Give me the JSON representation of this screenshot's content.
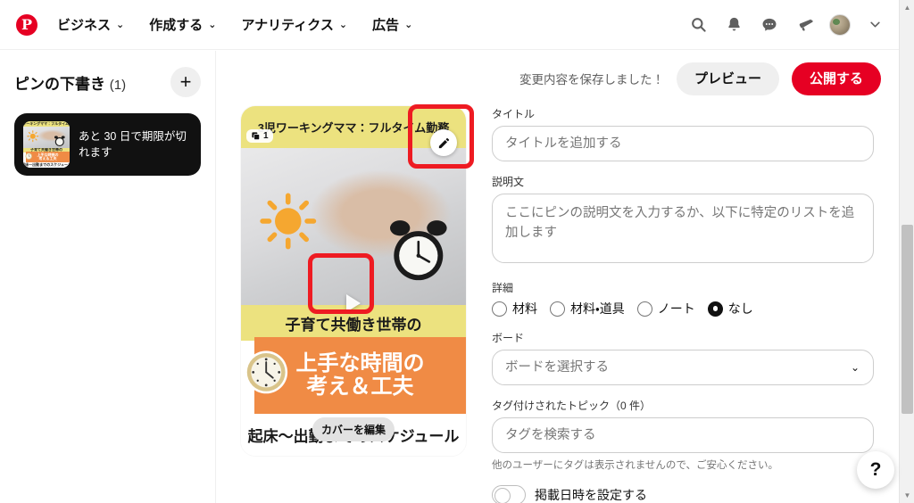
{
  "navbar": {
    "logo": "pinterest-logo",
    "items": [
      {
        "label": "ビジネス",
        "icon": "chevron-down-icon"
      },
      {
        "label": "作成する",
        "icon": "chevron-down-icon"
      },
      {
        "label": "アナリティクス",
        "icon": "chevron-down-icon"
      },
      {
        "label": "広告",
        "icon": "chevron-down-icon"
      }
    ],
    "right_icons": [
      "search-icon",
      "bell-icon",
      "chat-icon",
      "megaphone-icon",
      "avatar",
      "chevron-down-icon"
    ],
    "chevron": "⌄"
  },
  "sidebar": {
    "title": "ピンの下書き",
    "count": "(1)",
    "add_button": "+",
    "draft": {
      "expiry_text": "あと 30 日で期限が切れます",
      "thumb_name": "draft-thumbnail"
    }
  },
  "actionbar": {
    "saved_text": "変更内容を保存しました！",
    "preview_label": "プレビュー",
    "publish_label": "公開する"
  },
  "pin_preview": {
    "carousel_count": "1",
    "edit_icon": "pencil-icon",
    "play_icon": "play-triangle-icon",
    "cover_edit_label": "カバーを編集",
    "art": {
      "band_top": "3児ワーキングママ：フルタイム勤務",
      "band_mid": "子育て共働き世帯の",
      "headline_1": "上手な時間の",
      "headline_2": "考え＆工夫",
      "band_bottom": "起床〜出勤までのスケジュール",
      "colors": {
        "yellow": "#ece27f",
        "orange": "#f08b45",
        "sun": "#f5a730"
      }
    },
    "annotations": [
      {
        "name": "annotation-edit-button",
        "color": "#ee1b22"
      },
      {
        "name": "annotation-play-button",
        "color": "#ee1b22"
      }
    ]
  },
  "form": {
    "title": {
      "label": "タイトル",
      "value": "",
      "placeholder": "タイトルを追加する"
    },
    "description": {
      "label": "説明文",
      "value": "",
      "placeholder": "ここにピンの説明文を入力するか、以下に特定のリストを追加します"
    },
    "details": {
      "label": "詳細",
      "options": [
        {
          "label": "材料",
          "selected": false
        },
        {
          "label": "材料・道具",
          "selected": false
        },
        {
          "label": "ノート",
          "selected": false
        },
        {
          "label": "なし",
          "selected": true
        }
      ]
    },
    "board": {
      "label": "ボード",
      "value": "",
      "placeholder": "ボードを選択する",
      "chevron": "⌄"
    },
    "tags": {
      "label": "タグ付けされたトピック（0 件）",
      "value": "",
      "placeholder": "タグを検索する",
      "hint": "他のユーザーにタグは表示されませんので、ご安心ください。"
    },
    "schedule": {
      "label": "掲載日時を設定する",
      "enabled": false
    }
  },
  "help": {
    "label": "?"
  },
  "scrollbar": {
    "up": "▲",
    "down": "▼"
  },
  "colors": {
    "brand_red": "#e60023",
    "annotation_red": "#ee1b22",
    "button_gray": "#efefef",
    "text_dark": "#111111",
    "text_muted": "#767676"
  }
}
